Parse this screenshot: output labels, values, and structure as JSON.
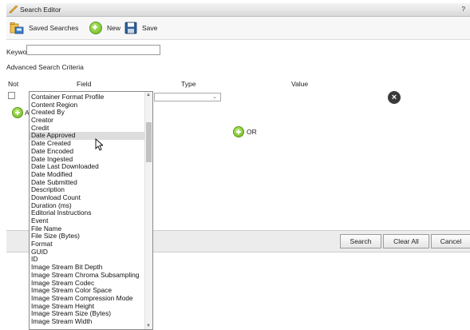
{
  "window": {
    "title": "Search Editor",
    "help": "?"
  },
  "toolbar": {
    "saved_searches": "Saved Searches",
    "new": "New",
    "save": "Save"
  },
  "keyword": {
    "label": "Keyword",
    "value": ""
  },
  "advanced": {
    "label": "Advanced Search Criteria"
  },
  "columns": {
    "not": "Not",
    "field": "Field",
    "type": "Type",
    "value": "Value"
  },
  "criteria": {
    "add_and_partial": "A",
    "or_label": "OR"
  },
  "buttons": {
    "search": "Search",
    "clear_all": "Clear All",
    "cancel": "Cancel"
  },
  "field_dropdown": {
    "highlighted": "Date Approved",
    "items": [
      "Container Format Profile",
      "Content Region",
      "Created By",
      "Creator",
      "Credit",
      "Date Approved",
      "Date Created",
      "Date Encoded",
      "Date Ingested",
      "Date Last Downloaded",
      "Date Modified",
      "Date Submitted",
      "Description",
      "Download Count",
      "Duration (ms)",
      "Editorial Instructions",
      "Event",
      "File Name",
      "File Size (Bytes)",
      "Format",
      "GUID",
      "ID",
      "Image Stream Bit Depth",
      "Image Stream Chroma Subsampling",
      "Image Stream Codec",
      "Image Stream Color Space",
      "Image Stream Compression Mode",
      "Image Stream Height",
      "Image Stream Size (Bytes)",
      "Image Stream Width"
    ]
  }
}
